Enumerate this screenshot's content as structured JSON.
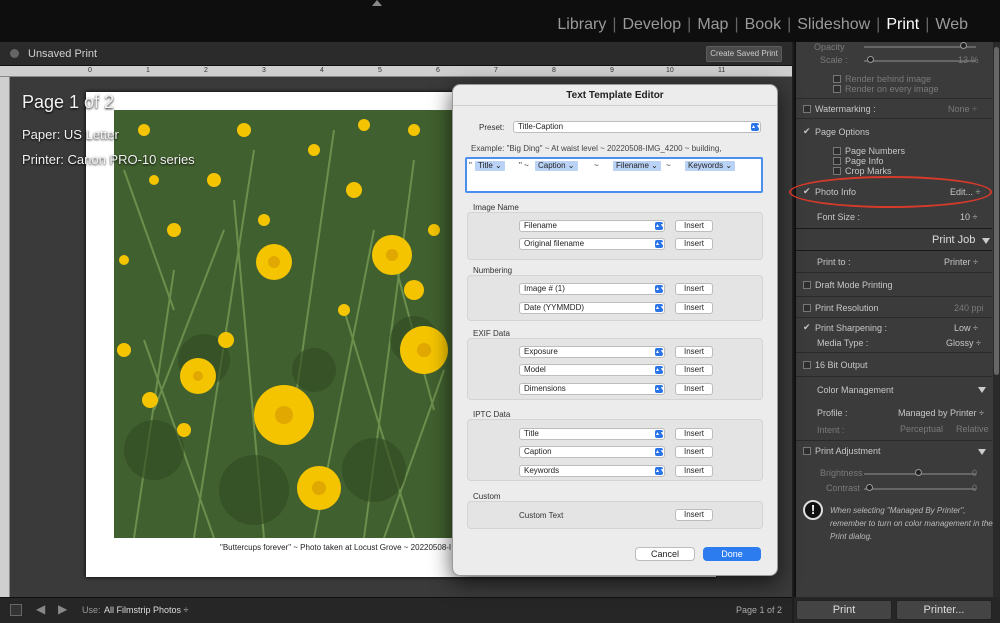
{
  "modules": {
    "items": [
      "Library",
      "Develop",
      "Map",
      "Book",
      "Slideshow",
      "Print",
      "Web"
    ],
    "active": "Print"
  },
  "header": {
    "doc_title": "Unsaved Print",
    "create_saved_print": "Create Saved Print"
  },
  "ruler": {
    "marks": [
      "0",
      "1",
      "2",
      "3",
      "4",
      "5",
      "6",
      "7",
      "8",
      "9",
      "10",
      "11"
    ]
  },
  "page_overlay": {
    "page": "Page 1 of 2",
    "paper": "Paper:  US Letter",
    "printer": "Printer:  Canon PRO-10 series"
  },
  "photo": {
    "caption": "\"Buttercups forever\" ~ Photo taken at Locust Grove ~ 20220508-I"
  },
  "dialog": {
    "title": "Text Template Editor",
    "preset_label": "Preset:",
    "preset_value": "Title-Caption",
    "example": "Example:  \"Big Ding\" ~ At waist level ~ 20220508-IMG_4200 ~ building,",
    "tokens": [
      {
        "prefix": "\"",
        "label": "Title ⌄"
      },
      {
        "prefix": "\" ~",
        "label": "Caption ⌄"
      },
      {
        "prefix": "~",
        "label": "Filename ⌄"
      },
      {
        "prefix": "~",
        "label": "Keywords ⌄"
      }
    ],
    "insert_label": "Insert",
    "groups": [
      {
        "name": "Image Name",
        "rows": [
          "Filename",
          "Original filename"
        ]
      },
      {
        "name": "Numbering",
        "rows": [
          "Image # (1)",
          "Date (YYMMDD)"
        ]
      },
      {
        "name": "EXIF Data",
        "rows": [
          "Exposure",
          "Model",
          "Dimensions"
        ]
      },
      {
        "name": "IPTC Data",
        "rows": [
          "Title",
          "Caption",
          "Keywords"
        ]
      }
    ],
    "custom": {
      "name": "Custom",
      "label": "Custom Text"
    },
    "cancel": "Cancel",
    "done": "Done"
  },
  "right_panel": {
    "opacity_label": "Opacity",
    "scale_label": "Scale :",
    "scale_value": "13 %",
    "opacity_level": 0.92,
    "scale_level": 0.06,
    "render_behind": "Render behind image",
    "render_every": "Render on every image",
    "watermarking": "Watermarking :",
    "watermarking_value": "None ÷",
    "page_options": "Page Options",
    "page_numbers": "Page Numbers",
    "page_info": "Page Info",
    "crop_marks": "Crop Marks",
    "photo_info": "Photo Info",
    "photo_info_value": "Edit... ÷",
    "font_size": "Font Size :",
    "font_size_value": "10 ÷",
    "print_job": "Print Job",
    "print_to": "Print to :",
    "print_to_value": "Printer ÷",
    "draft_mode": "Draft Mode Printing",
    "print_resolution": "Print Resolution",
    "print_resolution_value": "240 ppi",
    "print_sharpening": "Print Sharpening :",
    "print_sharpening_value": "Low ÷",
    "media_type": "Media Type :",
    "media_type_value": "Glossy ÷",
    "bit_output": "16 Bit Output",
    "color_management": "Color Management",
    "profile": "Profile :",
    "profile_value": "Managed by Printer ÷",
    "intent": "Intent :",
    "perceptual": "Perceptual",
    "relative": "Relative",
    "print_adjustment": "Print Adjustment",
    "brightness": "Brightness",
    "brightness_value": "0",
    "contrast": "Contrast",
    "contrast_value": "0",
    "brightness_level": 0.5,
    "contrast_level": 0.05,
    "note": [
      "When selecting \"Managed By Printer\",",
      "remember to turn on color management in the",
      "Print dialog."
    ],
    "print_button": "Print",
    "printer_button": "Printer..."
  },
  "filmstrip": {
    "use_label": "Use:",
    "use_value": "All Filmstrip Photos ÷",
    "page_count": "Page 1 of 2"
  },
  "colors": {
    "accent_blue": "#2c7cf0",
    "highlight_red": "#d63a2a",
    "flower_yellow": "#f4c400"
  }
}
